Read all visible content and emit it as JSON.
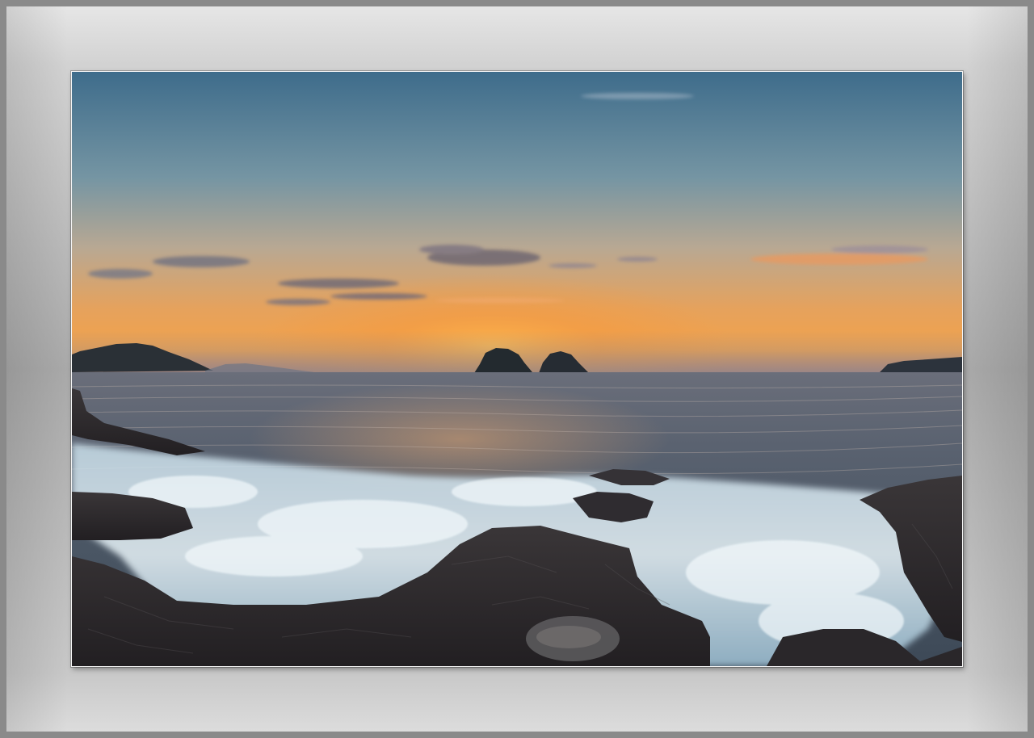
{
  "scene": {
    "subject": "sunset-seascape",
    "colors": {
      "sky_top": "#3f6d8c",
      "sky_mid": "#8fa6a8",
      "sky_glow": "#f0a04a",
      "horizon_glow": "#f7b25a",
      "sea": "#4d5a68",
      "foam": "#dfeef5",
      "rock": "#2c2a2c",
      "mat_light": "#e2e2e2",
      "mat_dark": "#a8a8a8"
    }
  }
}
